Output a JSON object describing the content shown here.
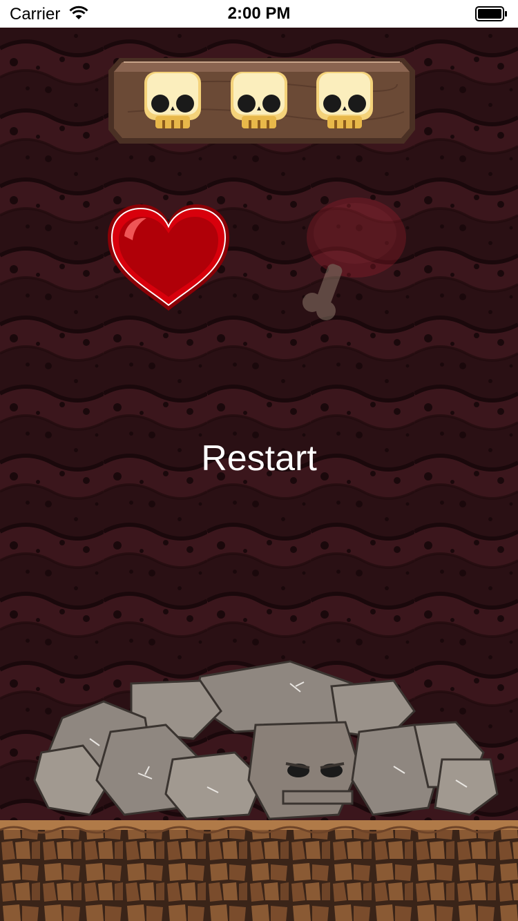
{
  "status_bar": {
    "carrier": "Carrier",
    "time": "2:00 PM"
  },
  "game": {
    "restart_label": "Restart",
    "skulls_shown": 3,
    "heart_icon": "heart-icon",
    "meat_icon": "meat-icon",
    "skull_icon": "skull-icon"
  },
  "colors": {
    "background_dark": "#2a1014",
    "background_stripe": "#3b161c",
    "heart_red": "#c8000a",
    "wood": "#6b4a36",
    "skull_cream": "#f8e2a0",
    "text": "#ffffff"
  }
}
